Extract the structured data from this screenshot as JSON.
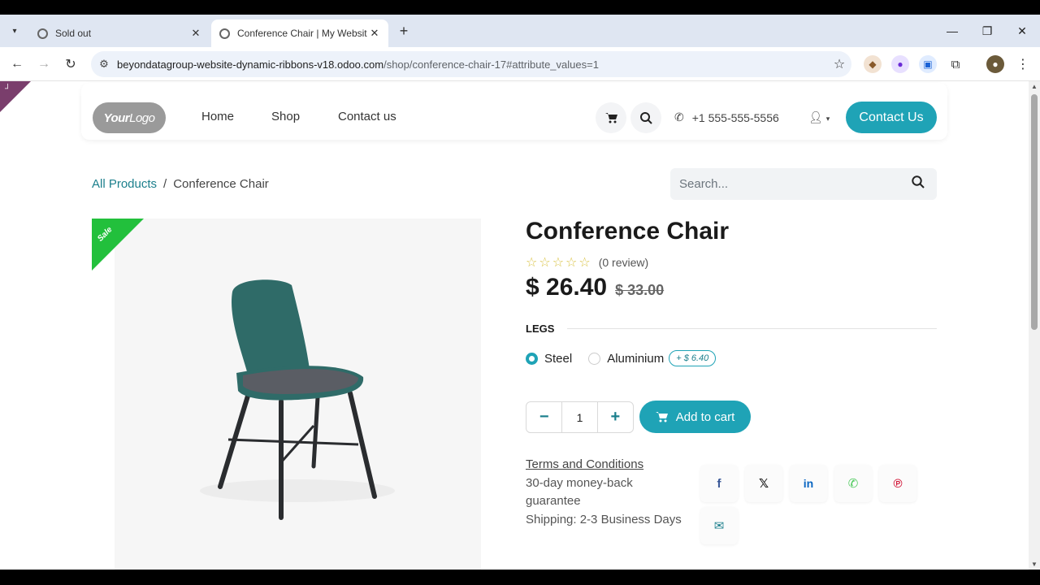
{
  "browser": {
    "tabs": [
      {
        "title": "Sold out",
        "active": false
      },
      {
        "title": "Conference Chair | My Website",
        "active": true
      }
    ],
    "url_host": "beyondatagroup-website-dynamic-ribbons-v18.odoo.com",
    "url_path": "/shop/conference-chair-17#attribute_values=1"
  },
  "header": {
    "logo_bold": "Your",
    "logo_light": "Logo",
    "menu": [
      "Home",
      "Shop",
      "Contact us"
    ],
    "phone": "+1 555-555-5556",
    "contact_button": "Contact Us"
  },
  "breadcrumb": {
    "parent": "All Products",
    "separator": "/",
    "current": "Conference Chair"
  },
  "search": {
    "placeholder": "Search..."
  },
  "product": {
    "ribbon": "Sale",
    "title": "Conference Chair",
    "reviews": "(0 review)",
    "rating": 0,
    "price": "$ 26.40",
    "old_price": "$ 33.00",
    "attribute_name": "LEGS",
    "options": [
      {
        "label": "Steel",
        "selected": true
      },
      {
        "label": "Aluminium",
        "selected": false,
        "extra": "+ $ 6.40"
      }
    ],
    "quantity": "1",
    "add_to_cart": "Add to cart",
    "terms_link": "Terms and Conditions",
    "guarantee": "30-day money-back guarantee",
    "shipping": "Shipping: 2-3 Business Days"
  },
  "share_icons": [
    "facebook-icon",
    "x-icon",
    "linkedin-icon",
    "whatsapp-icon",
    "pinterest-icon",
    "email-icon"
  ],
  "colors": {
    "accent": "#1fa3b6",
    "sale_ribbon": "#22c03c",
    "chair_seat": "#2f6b68"
  }
}
